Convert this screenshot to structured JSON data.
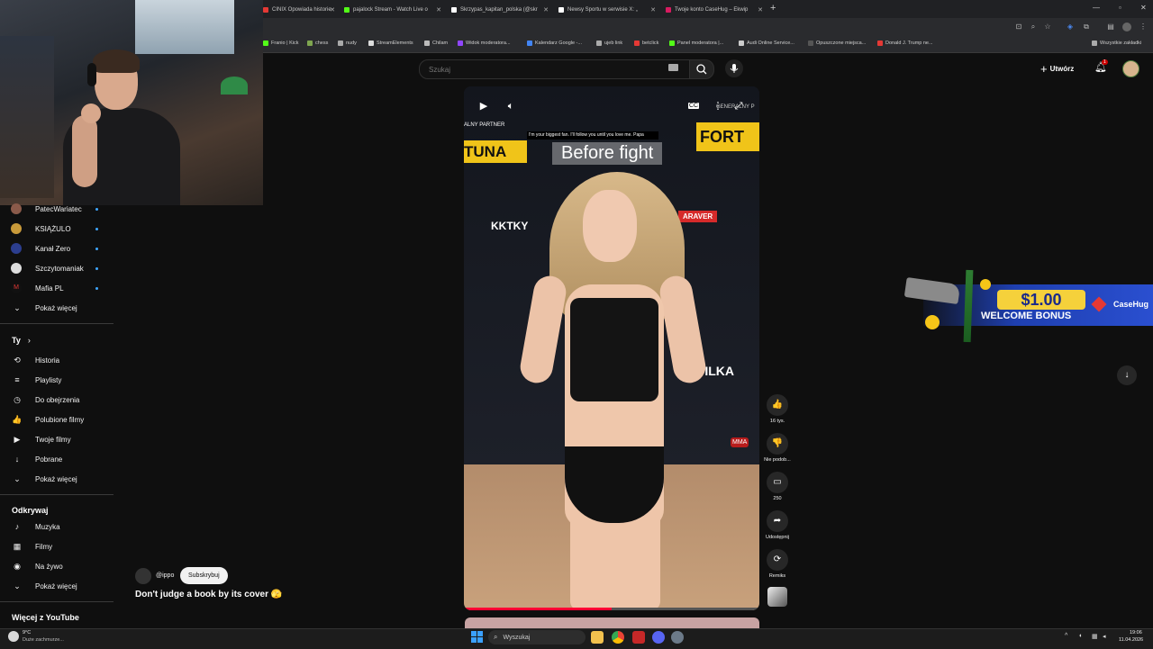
{
  "browser": {
    "tabs": [
      {
        "label": "CINIX Opowiada historie",
        "color": "#e53935"
      },
      {
        "label": "pajalock Stream - Watch Live o",
        "color": "#53fc18"
      },
      {
        "label": "Skrzypas_kapitan_polska (@skr",
        "color": "#ffffff"
      },
      {
        "label": "Newsy Sportu w serwisie X: „",
        "color": "#ffffff"
      },
      {
        "label": "Twoje konto CaseHug – Ekwip",
        "color": "#d81b60"
      }
    ],
    "new_tab": "+",
    "bookmarks": [
      {
        "label": "Franio | Kick",
        "color": "#53fc18"
      },
      {
        "label": "chess",
        "color": "#7fa650"
      },
      {
        "label": "nudy",
        "color": "#aaaaaa"
      },
      {
        "label": "StreamElements",
        "color": "#dddddd"
      },
      {
        "label": "Chilam",
        "color": "#bbbbbb"
      },
      {
        "label": "Widok moderatora...",
        "color": "#9146ff"
      },
      {
        "label": "Kalendarz Google -...",
        "color": "#4285f4"
      },
      {
        "label": "ujeb link",
        "color": "#aaaaaa"
      },
      {
        "label": "betclick",
        "color": "#e53935"
      },
      {
        "label": "Panel moderatora |...",
        "color": "#53fc18"
      },
      {
        "label": "Audi Online Service...",
        "color": "#cccccc"
      },
      {
        "label": "Opuszczone miejsca...",
        "color": "#555555"
      },
      {
        "label": "Donald J. Trump ne...",
        "color": "#e53935"
      }
    ],
    "all_bookmarks": "Wszystkie zakładki"
  },
  "sidebar": {
    "subscriptions": [
      {
        "label": "PatecWariatec",
        "color": "#8a5a4a"
      },
      {
        "label": "KSIĄŻULO",
        "color": "#c99a3a"
      },
      {
        "label": "Kanał Zero",
        "color": "#2c3e8f"
      },
      {
        "label": "Szczytomaniak",
        "color": "#dddddd"
      },
      {
        "label": "Mafia PL",
        "color": "#e53935"
      }
    ],
    "show_more_1": "Pokaż więcej",
    "you_header": "Ty",
    "you_items": [
      {
        "label": "Historia",
        "icon": "history-icon",
        "glyph": "⟲"
      },
      {
        "label": "Playlisty",
        "icon": "playlist-icon",
        "glyph": "≡"
      },
      {
        "label": "Do obejrzenia",
        "icon": "clock-icon",
        "glyph": "◷"
      },
      {
        "label": "Polubione filmy",
        "icon": "thumbs-up-icon",
        "glyph": "👍"
      },
      {
        "label": "Twoje filmy",
        "icon": "play-square-icon",
        "glyph": "▶"
      },
      {
        "label": "Pobrane",
        "icon": "download-icon",
        "glyph": "↓"
      }
    ],
    "show_more_2": "Pokaż więcej",
    "explore_header": "Odkrywaj",
    "explore_items": [
      {
        "label": "Muzyka",
        "icon": "music-icon",
        "glyph": "♪"
      },
      {
        "label": "Filmy",
        "icon": "film-icon",
        "glyph": "▦"
      },
      {
        "label": "Na żywo",
        "icon": "live-icon",
        "glyph": "◉"
      }
    ],
    "show_more_3": "Pokaż więcej",
    "more_header": "Więcej z YouTube"
  },
  "header": {
    "search_placeholder": "Szukaj",
    "create_label": "Utwórz",
    "notifications_count": "1"
  },
  "video": {
    "caption_small": "I'm your biggest fan. I'll follow you until you love me. Papa",
    "caption_big": "Before fight",
    "progress": 0.5,
    "banners": {
      "fortuna_left": "TUNA",
      "fortuna_right": "FORT",
      "partner": "ALNY PARTNER",
      "kktky": "KKTKY",
      "araver": "ARAVER",
      "pilka": "PILKA",
      "mma": "MMA",
      "generalny": "GENERALNY P"
    }
  },
  "actions": [
    {
      "icon": "thumbs-up-icon",
      "glyph": "👍",
      "label": "16 tys."
    },
    {
      "icon": "thumbs-down-icon",
      "glyph": "👎",
      "label": "Nie podob..."
    },
    {
      "icon": "comment-icon",
      "glyph": "▭",
      "label": "250"
    },
    {
      "icon": "share-icon",
      "glyph": "➦",
      "label": "Udostępnij"
    },
    {
      "icon": "remix-icon",
      "glyph": "⟳",
      "label": "Remiks"
    }
  ],
  "channel": {
    "handle": "@ippo",
    "subscribe_label": "Subskrybuj",
    "title": "Don't judge a book by its cover 🫣"
  },
  "ad": {
    "price": "$1.00",
    "bonus": "WELCOME BONUS",
    "brand": "CaseHug"
  },
  "taskbar": {
    "weather_temp": "9°C",
    "weather_desc": "Duże zachmurze...",
    "search_label": "Wyszukaj",
    "time": "19:06",
    "date": "11.04.2026"
  }
}
